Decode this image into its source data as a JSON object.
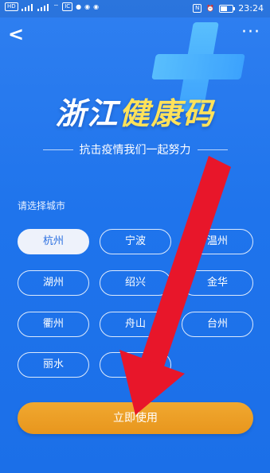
{
  "status_bar": {
    "left_icons": [
      "sim-icon",
      "signal-icon",
      "signal-icon",
      "wifi-icon",
      "app-notification-icon",
      "chat-icon",
      "wechat-icon",
      "wechat-icon"
    ],
    "time": "23:24",
    "battery_level": 0.6
  },
  "header": {
    "back_glyph": "<",
    "more_glyph": "···"
  },
  "banner": {
    "title_part1": "浙江",
    "title_part2": "健康码",
    "subtitle": "抗击疫情我们一起努力"
  },
  "city_section": {
    "label": "请选择城市",
    "cities": [
      "杭州",
      "宁波",
      "温州",
      "湖州",
      "绍兴",
      "金华",
      "衢州",
      "舟山",
      "台州",
      "丽水",
      "嘉兴"
    ],
    "selected": "杭州"
  },
  "action": {
    "use_label": "立即使用"
  },
  "colors": {
    "background": "#1f74ec",
    "button": "#e8961d",
    "title_highlight": "#ffe25a",
    "annotation_arrow": "#e8162a"
  }
}
